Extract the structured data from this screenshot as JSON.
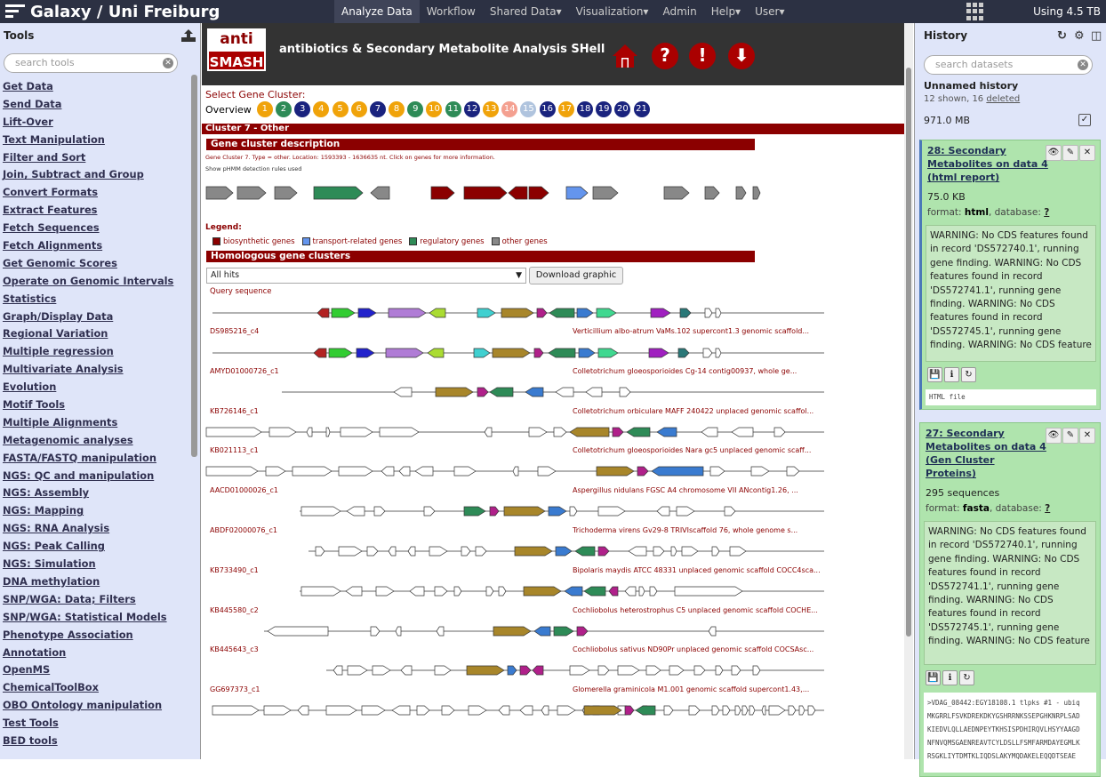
{
  "masthead": {
    "title": "Galaxy / Uni Freiburg",
    "nav": [
      "Analyze Data",
      "Workflow",
      "Shared Data▾",
      "Visualization▾",
      "Admin",
      "Help▾",
      "User▾"
    ],
    "quota": "Using 4.5 TB"
  },
  "tools": {
    "header": "Tools",
    "search_placeholder": "search tools",
    "items": [
      "Get Data",
      "Send Data",
      "Lift-Over",
      "Text Manipulation",
      "Filter and Sort",
      "Join, Subtract and Group",
      "Convert Formats",
      "Extract Features",
      "Fetch Sequences",
      "Fetch Alignments",
      "Get Genomic Scores",
      "Operate on Genomic Intervals",
      "Statistics",
      "Graph/Display Data",
      "Regional Variation",
      "Multiple regression",
      "Multivariate Analysis",
      "Evolution",
      "Motif Tools",
      "Multiple Alignments",
      "Metagenomic analyses",
      "FASTA/FASTQ manipulation",
      "NGS: QC and manipulation",
      "NGS: Assembly",
      "NGS: Mapping",
      "NGS: RNA Analysis",
      "NGS: Peak Calling",
      "NGS: Simulation",
      "DNA methylation",
      "SNP/WGA: Data; Filters",
      "SNP/WGA: Statistical Models",
      "Phenotype Association",
      "Annotation",
      "OpenMS",
      "ChemicalToolBox",
      "OBO Ontology manipulation",
      "Test Tools",
      "BED tools"
    ]
  },
  "antismash": {
    "logo_top": "anti",
    "logo_bottom": "SMASH",
    "title": "antibiotics & Secondary Metabolite Analysis SHell",
    "select_label": "Select Gene Cluster:",
    "overview": "Overview",
    "clusters": [
      {
        "n": "1",
        "c": "#f0a30a"
      },
      {
        "n": "2",
        "c": "#2e8b57"
      },
      {
        "n": "3",
        "c": "#1a237e"
      },
      {
        "n": "4",
        "c": "#f0a30a"
      },
      {
        "n": "5",
        "c": "#f0a30a"
      },
      {
        "n": "6",
        "c": "#f0a30a"
      },
      {
        "n": "7",
        "c": "#1a237e"
      },
      {
        "n": "8",
        "c": "#f0a30a"
      },
      {
        "n": "9",
        "c": "#2e8b57"
      },
      {
        "n": "10",
        "c": "#f0a30a"
      },
      {
        "n": "11",
        "c": "#2e8b57"
      },
      {
        "n": "12",
        "c": "#1a237e"
      },
      {
        "n": "13",
        "c": "#f0a30a"
      },
      {
        "n": "14",
        "c": "#f4a090"
      },
      {
        "n": "15",
        "c": "#b0c4de"
      },
      {
        "n": "16",
        "c": "#1a237e"
      },
      {
        "n": "17",
        "c": "#f0a30a"
      },
      {
        "n": "18",
        "c": "#1a237e"
      },
      {
        "n": "19",
        "c": "#1a237e"
      },
      {
        "n": "20",
        "c": "#1a237e"
      },
      {
        "n": "21",
        "c": "#1a237e"
      }
    ],
    "cluster_title": "Cluster 7 - Other",
    "desc_head": "Gene cluster description",
    "desc_text": "Gene Cluster 7. Type = other. Location: 1593393 - 1636635 nt. Click on genes for more information.",
    "desc_rules": "Show pHMM detection rules used",
    "legend_label": "Legend:",
    "legend": [
      {
        "label": "biosynthetic genes",
        "c": "#8b0000"
      },
      {
        "label": "transport-related genes",
        "c": "#6495ed"
      },
      {
        "label": "regulatory genes",
        "c": "#2e8b57"
      },
      {
        "label": "other genes",
        "c": "#888888"
      }
    ],
    "homolog_head": "Homologous gene clusters",
    "dropdown_value": "All hits",
    "download_label": "Download graphic",
    "query_label": "Query sequence",
    "hits": [
      {
        "id": "DS985216_c4",
        "desc": "Verticillium albo-atrum VaMs.102 supercont1.3 genomic scaffold..."
      },
      {
        "id": "AMYD01000726_c1",
        "desc": "Colletotrichum gloeosporioides Cg-14 contig00937, whole ge..."
      },
      {
        "id": "KB726146_c1",
        "desc": "Colletotrichum orbiculare MAFF 240422 unplaced genomic scaffol..."
      },
      {
        "id": "KB021113_c1",
        "desc": "Colletotrichum gloeosporioides Nara gc5 unplaced genomic scaff..."
      },
      {
        "id": "AACD01000026_c1",
        "desc": "Aspergillus nidulans FGSC A4 chromosome VII ANcontig1.26, ..."
      },
      {
        "id": "ABDF02000076_c1",
        "desc": "Trichoderma virens Gv29-8 TRIVIscaffold 76, whole genome s..."
      },
      {
        "id": "KB733490_c1",
        "desc": "Bipolaris maydis ATCC 48331 unplaced genomic scaffold COCC4sca..."
      },
      {
        "id": "KB445580_c2",
        "desc": "Cochliobolus heterostrophus C5 unplaced genomic scaffold COCHE..."
      },
      {
        "id": "KB445643_c3",
        "desc": "Cochliobolus sativus ND90Pr unplaced genomic scaffold COCSAsc..."
      },
      {
        "id": "GG697373_c1",
        "desc": "Glomerella graminicola M1.001 genomic scaffold supercont1.43,..."
      }
    ]
  },
  "history": {
    "header": "History",
    "search_placeholder": "search datasets",
    "name": "Unnamed history",
    "shown": "12 shown, 16 ",
    "deleted": "deleted",
    "size": "971.0 MB",
    "format_label": "format: ",
    "database_label": ", database: ",
    "datasets": [
      {
        "title": "28: Secondary Metabolites on data 4 (html report)",
        "info": "75.0 KB",
        "format": "html",
        "database": "?",
        "warnings": "WARNING: No CDS features found in record 'DS572740.1', running gene finding. WARNING: No CDS features found in record 'DS572741.1', running gene finding. WARNING: No CDS features found in record 'DS572745.1', running gene finding. WARNING: No CDS feature",
        "peek": "HTML file"
      },
      {
        "title": "27: Secondary Metabolites on data 4 (Gen Cluster Proteins)",
        "info": "295 sequences",
        "format": "fasta",
        "database": "?",
        "warnings": "WARNING: No CDS features found in record 'DS572740.1', running gene finding. WARNING: No CDS features found in record 'DS572741.1', running gene finding. WARNING: No CDS features found in record 'DS572745.1', running gene finding. WARNING: No CDS feature",
        "peek_lines": [
          ">VDAG_08442:EGY18108.1 tlpks #1 - ubiq",
          "MKGRRLFSVKDREKDKYGSHRRNKSSEPGHKNRPLSAD",
          "KIEDVLQLLAEDNPEYTKHSISPDHIRQVLHSYYAAGD",
          "NFNVQMSGAENREAVTCYLDSLLFSMFARMDAYEGMLK",
          "RSGKLIYTDMTKLIQDSLAKYMQDAKELEQQDTSEAE"
        ]
      }
    ]
  }
}
